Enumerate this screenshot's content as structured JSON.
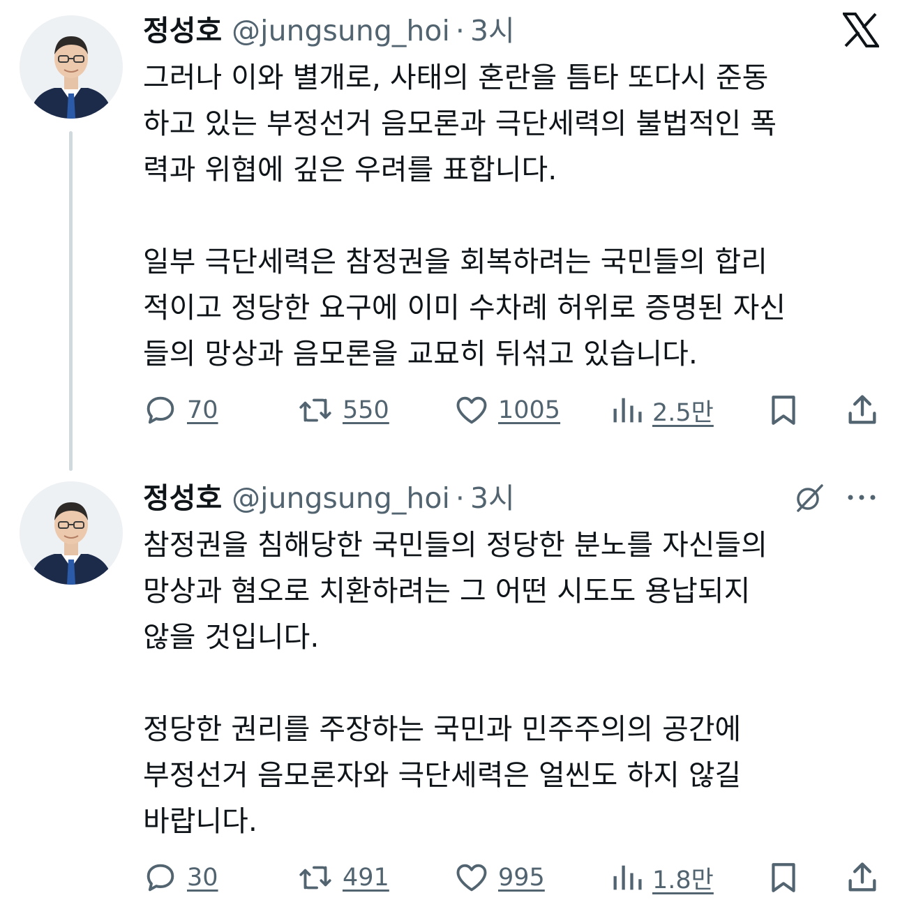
{
  "tweets": [
    {
      "author": {
        "display_name": "정성호",
        "handle": "@jungsung_hoi",
        "time_separator": "·",
        "time": "3시"
      },
      "paragraphs": [
        "그러나 이와 별개로, 사태의 혼란을 틈타 또다시 준동\n하고 있는 부정선거 음모론과 극단세력의 불법적인 폭\n력과 위협에 깊은 우려를 표합니다.",
        "일부 극단세력은 참정권을 회복하려는 국민들의 합리\n적이고 정당한 요구에 이미 수차례 허위로 증명된 자신\n들의 망상과 음모론을 교묘히 뒤섞고 있습니다."
      ],
      "stats": {
        "replies": "70",
        "retweets": "550",
        "likes": "1005",
        "views": "2.5만"
      }
    },
    {
      "author": {
        "display_name": "정성호",
        "handle": "@jungsung_hoi",
        "time_separator": "·",
        "time": "3시"
      },
      "paragraphs": [
        "참정권을 침해당한 국민들의 정당한 분노를 자신들의\n망상과 혐오로 치환하려는 그 어떤 시도도 용납되지\n않을 것입니다.",
        "정당한 권리를 주장하는 국민과 민주주의의 공간에\n부정선거 음모론자와 극단세력은 얼씬도 하지 않길\n바랍니다."
      ],
      "stats": {
        "replies": "30",
        "retweets": "491",
        "likes": "995",
        "views": "1.8만"
      }
    }
  ],
  "icons": {
    "platform_logo": "x-logo-icon",
    "grok": "grok-icon",
    "more": "more-dots-icon",
    "reply": "reply-icon",
    "retweet": "retweet-icon",
    "like": "heart-icon",
    "views": "views-bar-chart-icon",
    "bookmark": "bookmark-icon",
    "share": "share-icon"
  },
  "colors": {
    "text_primary": "#0f1419",
    "text_secondary": "#536471",
    "thread_line": "#cfd9de",
    "background": "#ffffff"
  }
}
